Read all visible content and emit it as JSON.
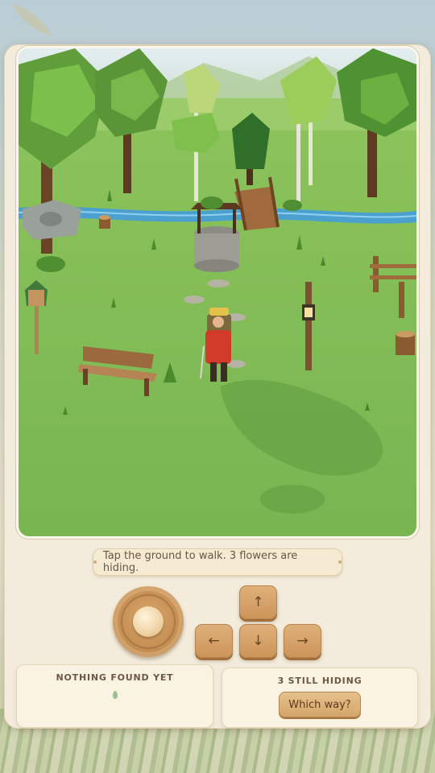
{
  "hint": {
    "text": "Tap the ground to walk. 3 flowers are hiding."
  },
  "controls": {
    "up": "↑",
    "down": "↓",
    "left": "←",
    "right": "→"
  },
  "found_panel": {
    "title": "NOTHING FOUND YET",
    "icon": "seed-icon"
  },
  "hiding_panel": {
    "title": "3 STILL HIDING",
    "button_label": "Which way?"
  },
  "colors": {
    "panel": "#f3ecdc",
    "grass": "#7fbd55",
    "button_wood": "#d4a56b",
    "text_brown": "#6c5843"
  }
}
